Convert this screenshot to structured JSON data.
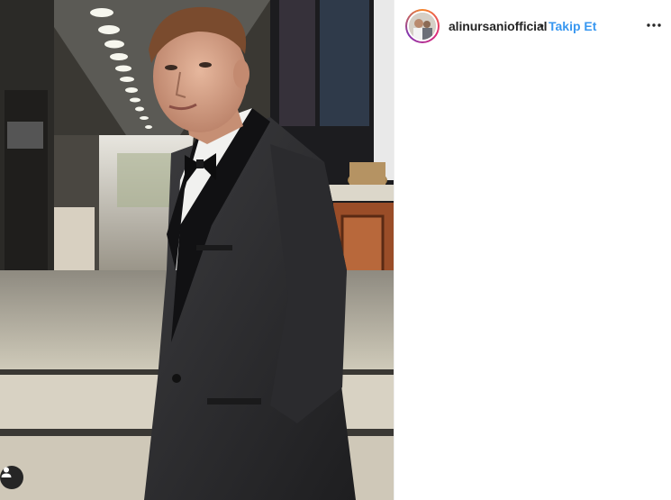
{
  "post": {
    "username": "alinursaniofficial",
    "separator": "•",
    "follow_label": "Takip Et",
    "more_icon": "ellipsis-icon",
    "user_tag_icon": "person-icon",
    "photo_alt": "alinursaniofficial post photo"
  },
  "colors": {
    "follow": "#3897f0",
    "username": "#262626"
  }
}
